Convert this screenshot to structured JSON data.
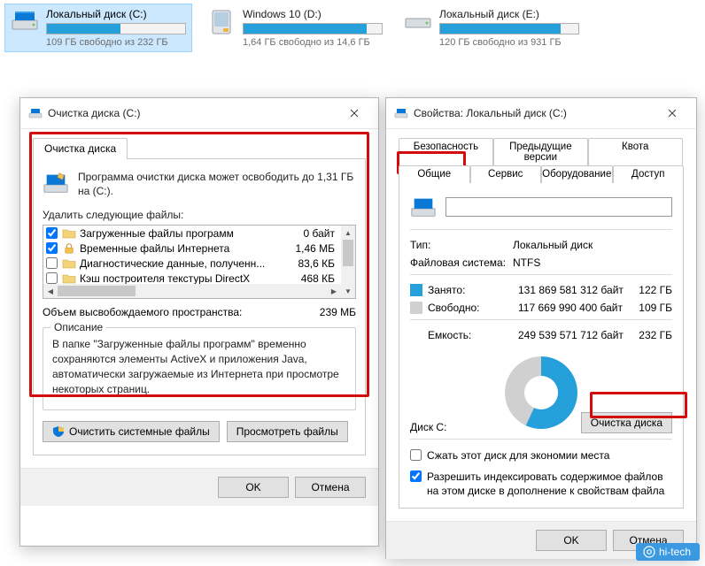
{
  "drives": [
    {
      "name": "Локальный диск (C:)",
      "free": "109 ГБ свободно из 232 ГБ",
      "fill_pct": 53
    },
    {
      "name": "Windows 10 (D:)",
      "free": "1,64 ГБ свободно из 14,6 ГБ",
      "fill_pct": 89
    },
    {
      "name": "Локальный диск (E:)",
      "free": "120 ГБ свободно из 931 ГБ",
      "fill_pct": 87
    }
  ],
  "cleanup": {
    "title": "Очистка диска  (C:)",
    "tab": "Очистка диска",
    "intro": "Программа очистки диска может освободить до 1,31 ГБ на  (C:).",
    "delete_label": "Удалить следующие файлы:",
    "files": [
      {
        "checked": true,
        "name": "Загруженные файлы программ",
        "size": "0 байт",
        "icon": "folder"
      },
      {
        "checked": true,
        "name": "Временные файлы Интернета",
        "size": "1,46 МБ",
        "icon": "lock"
      },
      {
        "checked": false,
        "name": "Диагностические данные, полученн...",
        "size": "83,6 КБ",
        "icon": "folder"
      },
      {
        "checked": false,
        "name": "Кэш построителя текстуры DirectX",
        "size": "468 КБ",
        "icon": "folder"
      }
    ],
    "total_label": "Объем высвобождаемого пространства:",
    "total_value": "239 МБ",
    "desc_title": "Описание",
    "desc_text": "В папке \"Загруженные файлы программ\" временно сохраняются элементы ActiveX и приложения Java, автоматически загружаемые из Интернета при просмотре некоторых страниц.",
    "btn_sys": "Очистить системные файлы",
    "btn_view": "Просмотреть файлы",
    "ok": "OK",
    "cancel": "Отмена"
  },
  "props": {
    "title": "Свойства: Локальный диск (C:)",
    "tabs_row1": [
      "Безопасность",
      "Предыдущие версии",
      "Квота"
    ],
    "tabs_row2": [
      "Общие",
      "Сервис",
      "Оборудование",
      "Доступ"
    ],
    "volume_name": "",
    "type_label": "Тип:",
    "type_value": "Локальный диск",
    "fs_label": "Файловая система:",
    "fs_value": "NTFS",
    "used_label": "Занято:",
    "used_bytes": "131 869 581 312 байт",
    "used_gb": "122 ГБ",
    "free_label": "Свободно:",
    "free_bytes": "117 669 990 400 байт",
    "free_gb": "109 ГБ",
    "cap_label": "Емкость:",
    "cap_bytes": "249 539 571 712 байт",
    "cap_gb": "232 ГБ",
    "caption": "Диск C:",
    "clean_button": "Очистка диска",
    "compress": "Сжать этот диск для экономии места",
    "index": "Разрешить индексировать содержимое файлов на этом диске в дополнение к свойствам файла",
    "ok": "OK",
    "cancel": "Отмена"
  },
  "watermark": "hi-tech"
}
